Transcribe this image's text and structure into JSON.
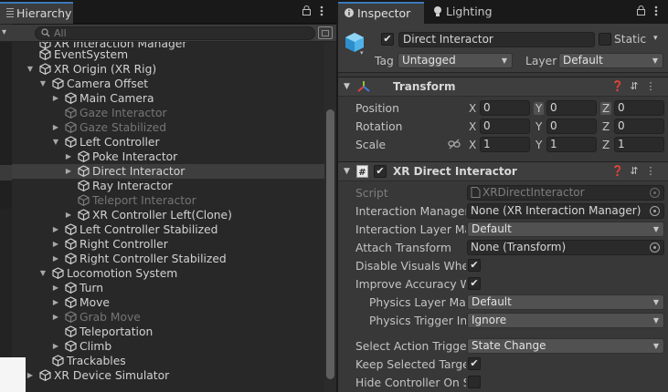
{
  "hierarchy": {
    "tab_label": "Hierarchy",
    "search_placeholder": "All",
    "rows": [
      {
        "label": "XR Interaction Manager",
        "depth": 1,
        "arrow": "",
        "state": "normal"
      },
      {
        "label": "EventSystem",
        "depth": 1,
        "arrow": "",
        "state": "normal"
      },
      {
        "label": "XR Origin (XR Rig)",
        "depth": 1,
        "arrow": "open",
        "state": "normal"
      },
      {
        "label": "Camera Offset",
        "depth": 2,
        "arrow": "open",
        "state": "normal"
      },
      {
        "label": "Main Camera",
        "depth": 3,
        "arrow": "closed",
        "state": "normal"
      },
      {
        "label": "Gaze Interactor",
        "depth": 3,
        "arrow": "",
        "state": "disabled"
      },
      {
        "label": "Gaze Stabilized",
        "depth": 3,
        "arrow": "closed",
        "state": "disabled"
      },
      {
        "label": "Left Controller",
        "depth": 3,
        "arrow": "open",
        "state": "normal"
      },
      {
        "label": "Poke Interactor",
        "depth": 4,
        "arrow": "closed",
        "state": "normal"
      },
      {
        "label": "Direct Interactor",
        "depth": 4,
        "arrow": "closed",
        "state": "selected"
      },
      {
        "label": "Ray Interactor",
        "depth": 4,
        "arrow": "",
        "state": "normal"
      },
      {
        "label": "Teleport Interactor",
        "depth": 4,
        "arrow": "",
        "state": "disabled"
      },
      {
        "label": "XR Controller Left(Clone)",
        "depth": 4,
        "arrow": "closed",
        "state": "normal"
      },
      {
        "label": "Left Controller Stabilized",
        "depth": 3,
        "arrow": "closed",
        "state": "normal"
      },
      {
        "label": "Right Controller",
        "depth": 3,
        "arrow": "closed",
        "state": "normal"
      },
      {
        "label": "Right Controller Stabilized",
        "depth": 3,
        "arrow": "closed",
        "state": "normal"
      },
      {
        "label": "Locomotion System",
        "depth": 2,
        "arrow": "open",
        "state": "normal"
      },
      {
        "label": "Turn",
        "depth": 3,
        "arrow": "closed",
        "state": "normal"
      },
      {
        "label": "Move",
        "depth": 3,
        "arrow": "closed",
        "state": "normal"
      },
      {
        "label": "Grab Move",
        "depth": 3,
        "arrow": "closed",
        "state": "disabled"
      },
      {
        "label": "Teleportation",
        "depth": 3,
        "arrow": "",
        "state": "normal"
      },
      {
        "label": "Climb",
        "depth": 3,
        "arrow": "closed",
        "state": "normal"
      },
      {
        "label": "Trackables",
        "depth": 2,
        "arrow": "",
        "state": "normal"
      },
      {
        "label": "XR Device Simulator",
        "depth": 1,
        "arrow": "closed",
        "state": "normal"
      }
    ]
  },
  "inspector": {
    "tabs": [
      "Inspector",
      "Lighting"
    ],
    "object": {
      "active": true,
      "name": "Direct Interactor",
      "static_label": "Static",
      "static": false,
      "tag_label": "Tag",
      "tag": "Untagged",
      "layer_label": "Layer",
      "layer": "Default"
    },
    "transform": {
      "title": "Transform",
      "position_label": "Position",
      "rotation_label": "Rotation",
      "scale_label": "Scale",
      "axes": [
        "X",
        "Y",
        "Z"
      ],
      "position": [
        "0",
        "0",
        "0"
      ],
      "rotation": [
        "0",
        "0",
        "0"
      ],
      "scale": [
        "1",
        "1",
        "1"
      ]
    },
    "component": {
      "title": "XR Direct Interactor",
      "enabled": true,
      "fields": [
        {
          "label": "Script",
          "value": "XRDirectInteractor",
          "kind": "object",
          "dim": true
        },
        {
          "label": "Interaction Manager",
          "value": "None (XR Interaction Manager)",
          "kind": "object"
        },
        {
          "label": "Interaction Layer Mas",
          "value": "Default",
          "kind": "dropdown"
        },
        {
          "label": "Attach Transform",
          "value": "None (Transform)",
          "kind": "object"
        },
        {
          "label": "Disable Visuals When",
          "value": true,
          "kind": "check"
        },
        {
          "label": "Improve Accuracy Wit",
          "value": true,
          "kind": "check"
        },
        {
          "label": "Physics Layer Mas",
          "value": "Default",
          "kind": "dropdown",
          "indent": true
        },
        {
          "label": "Physics Trigger Inte",
          "value": "Ignore",
          "kind": "dropdown",
          "indent": true
        },
        {
          "label": "Select Action Trigger",
          "value": "State Change",
          "kind": "dropdown"
        },
        {
          "label": "Keep Selected Target",
          "value": true,
          "kind": "check"
        },
        {
          "label": "Hide Controller On Se",
          "value": false,
          "kind": "check"
        }
      ]
    }
  },
  "colors": {
    "accent": "#3a79bb",
    "panel_bg": "#383838",
    "hierarchy_bg": "#282828",
    "selected_row": "#3e3e3e"
  }
}
